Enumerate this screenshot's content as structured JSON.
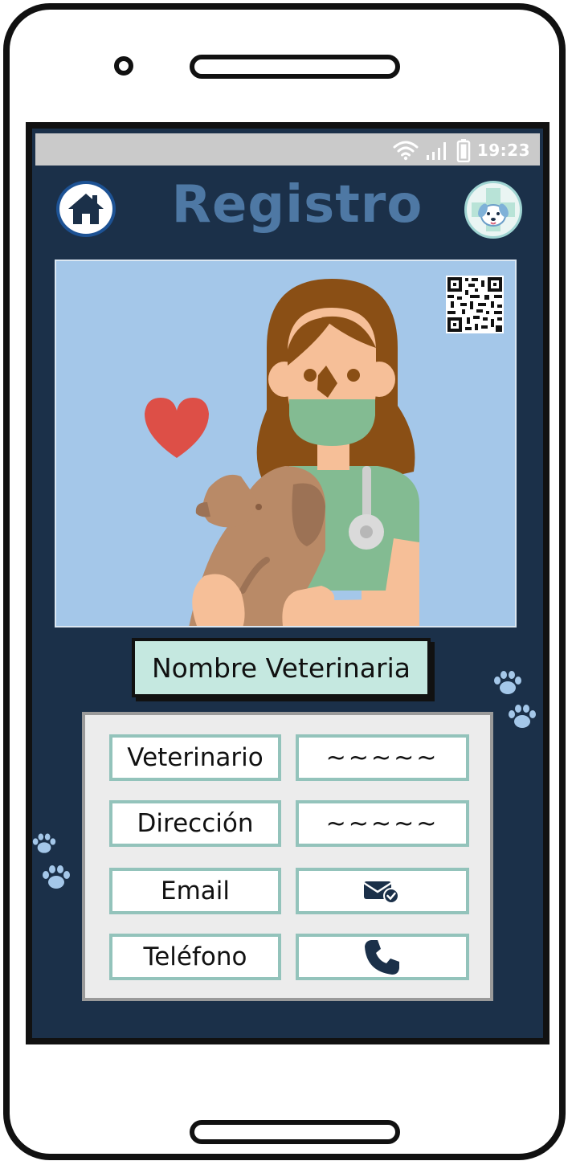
{
  "status_bar": {
    "time": "19:23"
  },
  "header": {
    "title": "Registro",
    "home_icon": "home-icon",
    "logo_icon": "vet-logo-icon"
  },
  "hero": {
    "illustration": "veterinarian-with-dog-illustration",
    "qr_icon": "qr-code-icon"
  },
  "clinic": {
    "name": "Nombre Veterinaria"
  },
  "info": {
    "rows": [
      {
        "label": "Veterinario",
        "value": "~~~~~"
      },
      {
        "label": "Dirección",
        "value": "~~~~~"
      },
      {
        "label": "Email",
        "value_icon": "email-verified-icon"
      },
      {
        "label": "Teléfono",
        "value_icon": "phone-icon"
      }
    ]
  },
  "colors": {
    "screen_bg": "#1b3049",
    "title": "#4e78a4",
    "hero_bg": "#a4c7e9",
    "name_box_bg": "#c5e8e0",
    "cell_border": "#93c3bb",
    "paw": "#a4c7e9",
    "icon_dark": "#1b3049"
  }
}
